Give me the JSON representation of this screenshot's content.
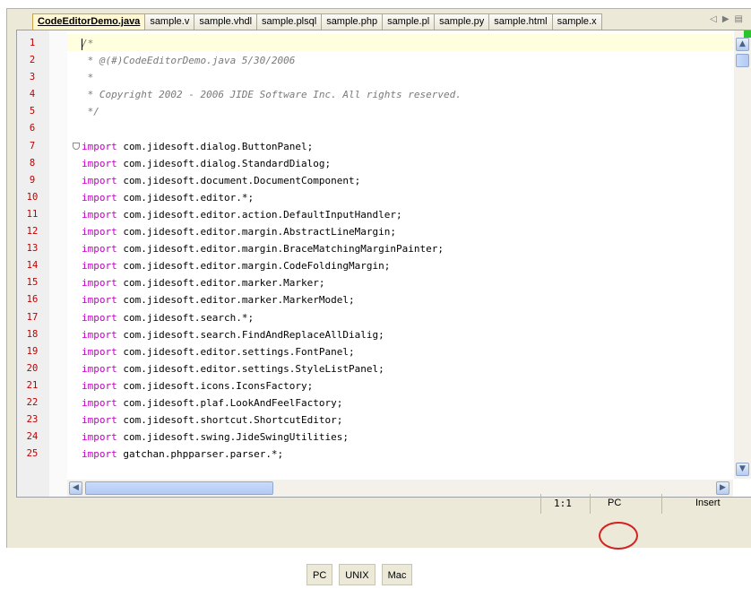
{
  "tabs": [
    {
      "label": "CodeEditorDemo.java",
      "active": true
    },
    {
      "label": "sample.v"
    },
    {
      "label": "sample.vhdl"
    },
    {
      "label": "sample.plsql"
    },
    {
      "label": "sample.php"
    },
    {
      "label": "sample.pl"
    },
    {
      "label": "sample.py"
    },
    {
      "label": "sample.html"
    },
    {
      "label": "sample.x"
    }
  ],
  "tab_nav": {
    "prev_icon": "triangle-left-icon",
    "next_icon": "triangle-right-icon",
    "list_icon": "list-icon"
  },
  "editor": {
    "lines": [
      {
        "n": "1",
        "comment": "/*"
      },
      {
        "n": "2",
        "comment": " * @(#)CodeEditorDemo.java 5/30/2006"
      },
      {
        "n": "3",
        "comment": " *"
      },
      {
        "n": "4",
        "comment": " * Copyright 2002 - 2006 JIDE Software Inc. All rights reserved."
      },
      {
        "n": "5",
        "comment": " */"
      },
      {
        "n": "6",
        "comment": ""
      },
      {
        "n": "7",
        "kw": "import",
        "rest": " com.jidesoft.dialog.ButtonPanel;"
      },
      {
        "n": "8",
        "kw": "import",
        "rest": " com.jidesoft.dialog.StandardDialog;"
      },
      {
        "n": "9",
        "kw": "import",
        "rest": " com.jidesoft.document.DocumentComponent;"
      },
      {
        "n": "10",
        "kw": "import",
        "rest": " com.jidesoft.editor.*;"
      },
      {
        "n": "11",
        "kw": "import",
        "rest": " com.jidesoft.editor.action.DefaultInputHandler;"
      },
      {
        "n": "12",
        "kw": "import",
        "rest": " com.jidesoft.editor.margin.AbstractLineMargin;"
      },
      {
        "n": "13",
        "kw": "import",
        "rest": " com.jidesoft.editor.margin.BraceMatchingMarginPainter;"
      },
      {
        "n": "14",
        "kw": "import",
        "rest": " com.jidesoft.editor.margin.CodeFoldingMargin;"
      },
      {
        "n": "15",
        "kw": "import",
        "rest": " com.jidesoft.editor.marker.Marker;"
      },
      {
        "n": "16",
        "kw": "import",
        "rest": " com.jidesoft.editor.marker.MarkerModel;"
      },
      {
        "n": "17",
        "kw": "import",
        "rest": " com.jidesoft.search.*;"
      },
      {
        "n": "18",
        "kw": "import",
        "rest": " com.jidesoft.search.FindAndReplaceAllDialig;"
      },
      {
        "n": "19",
        "kw": "import",
        "rest": " com.jidesoft.editor.settings.FontPanel;"
      },
      {
        "n": "20",
        "kw": "import",
        "rest": " com.jidesoft.editor.settings.StyleListPanel;"
      },
      {
        "n": "21",
        "kw": "import",
        "rest": " com.jidesoft.icons.IconsFactory;"
      },
      {
        "n": "22",
        "kw": "import",
        "rest": " com.jidesoft.plaf.LookAndFeelFactory;"
      },
      {
        "n": "23",
        "kw": "import",
        "rest": " com.jidesoft.shortcut.ShortcutEditor;"
      },
      {
        "n": "24",
        "kw": "import",
        "rest": " com.jidesoft.swing.JideSwingUtilities;"
      },
      {
        "n": "25",
        "kw": "import",
        "rest": " gatchan.phpparser.parser.*;"
      }
    ]
  },
  "status": {
    "position": "1:1",
    "line_ending": "PC",
    "mode": "Insert"
  },
  "eol_buttons": [
    "PC",
    "UNIX",
    "Mac"
  ],
  "colors": {
    "keyword": "#c000c0",
    "comment": "#7a7a7a",
    "line_number": "#c00000",
    "highlight_circle": "#d62020"
  }
}
